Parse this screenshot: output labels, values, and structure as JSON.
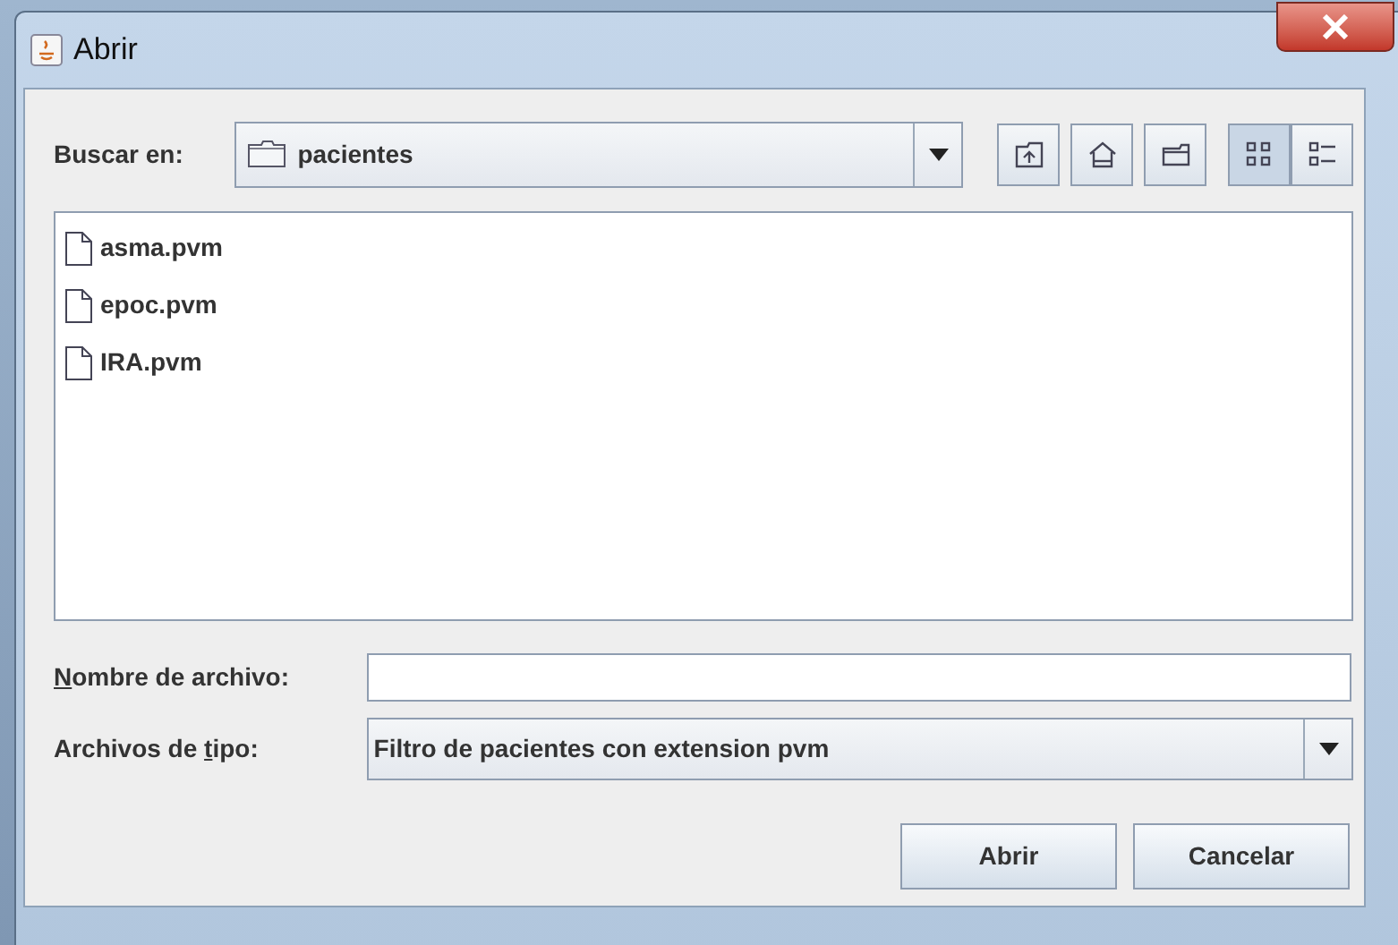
{
  "window": {
    "title": "Abrir"
  },
  "look_in": {
    "label": "Buscar en:",
    "value": "pacientes"
  },
  "toolbar": [
    {
      "kind": "up",
      "selected": false
    },
    {
      "kind": "home",
      "selected": false
    },
    {
      "kind": "new-folder",
      "selected": false
    },
    {
      "kind": "list",
      "selected": true
    },
    {
      "kind": "details",
      "selected": false
    }
  ],
  "files": [
    {
      "name": "asma.pvm",
      "selected": false
    },
    {
      "name": "epoc.pvm",
      "selected": false
    },
    {
      "name": "IRA.pvm",
      "selected": false
    }
  ],
  "file_name": {
    "label": {
      "key": "N",
      "after": "ombre de archivo:"
    }
  },
  "file_type": {
    "label": {
      "before": "Archivos de ",
      "key": "t",
      "after": "ipo:"
    },
    "value": "Filtro de pacientes con extension pvm"
  },
  "buttons": [
    "Abrir",
    "Cancelar"
  ]
}
